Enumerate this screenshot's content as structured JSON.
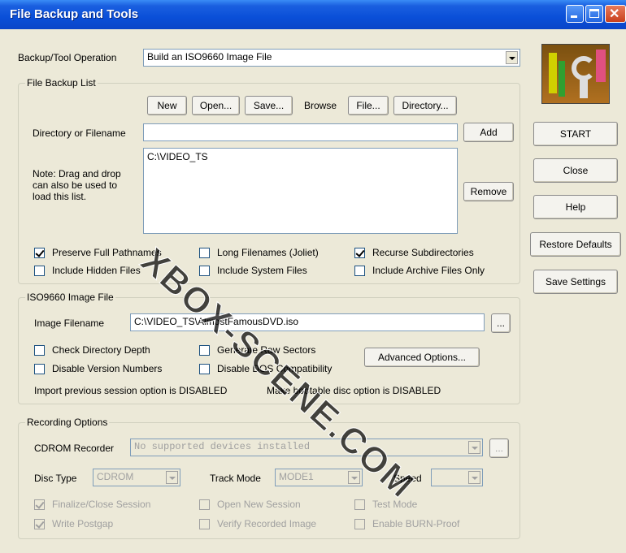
{
  "window": {
    "title": "File Backup and Tools"
  },
  "operation": {
    "label": "Backup/Tool Operation",
    "value": "Build an ISO9660 Image File"
  },
  "file_backup_list": {
    "title": "File Backup List",
    "new_label": "New",
    "open_label": "Open...",
    "save_label": "Save...",
    "browse_label": "Browse",
    "file_label": "File...",
    "directory_label": "Directory...",
    "dir_filename_label": "Directory or Filename",
    "dir_filename_value": "",
    "add_label": "Add",
    "note_line1": "Note: Drag and drop",
    "note_line2": "can also be used to",
    "note_line3": "load this list.",
    "list_items": [
      "C:\\VIDEO_TS"
    ],
    "remove_label": "Remove",
    "checkboxes": {
      "preserve": {
        "label": "Preserve Full Pathnames",
        "checked": true
      },
      "long_filenames": {
        "label": "Long Filenames (Joliet)",
        "checked": false
      },
      "recurse": {
        "label": "Recurse Subdirectories",
        "checked": true
      },
      "hidden": {
        "label": "Include Hidden Files",
        "checked": false
      },
      "system": {
        "label": "Include System Files",
        "checked": false
      },
      "archive": {
        "label": "Include Archive Files Only",
        "checked": false
      }
    }
  },
  "iso": {
    "title": "ISO9660 Image File",
    "filename_label": "Image Filename",
    "filename_value": "C:\\VIDEO_TS\\AlmostFamousDVD.iso",
    "browse_dots": "...",
    "check_dir_depth": "Check Directory Depth",
    "raw_sectors": "Generate Raw Sectors",
    "disable_version": "Disable Version Numbers",
    "disable_dos": "Disable DOS Compatibility",
    "advanced_label": "Advanced Options...",
    "import_status": "Import previous session option is  DISABLED",
    "bootable_status": "Make bootable disc option is DISABLED"
  },
  "recording": {
    "title": "Recording Options",
    "recorder_label": "CDROM Recorder",
    "recorder_value": "No supported devices installed",
    "dots": "...",
    "disc_type_label": "Disc Type",
    "disc_type_value": "CDROM",
    "track_mode_label": "Track Mode",
    "track_mode_value": "MODE1",
    "speed_label": "Speed",
    "speed_value": "",
    "finalize": "Finalize/Close Session",
    "open_session": "Open New Session",
    "test_mode": "Test Mode",
    "write_postgap": "Write Postgap",
    "verify_image": "Verify Recorded Image",
    "burn_proof": "Enable BURN-Proof"
  },
  "side_buttons": {
    "start": "START",
    "close": "Close",
    "help": "Help",
    "restore": "Restore Defaults",
    "save_settings": "Save Settings"
  },
  "watermark": "XBOX-SCENE.COM"
}
